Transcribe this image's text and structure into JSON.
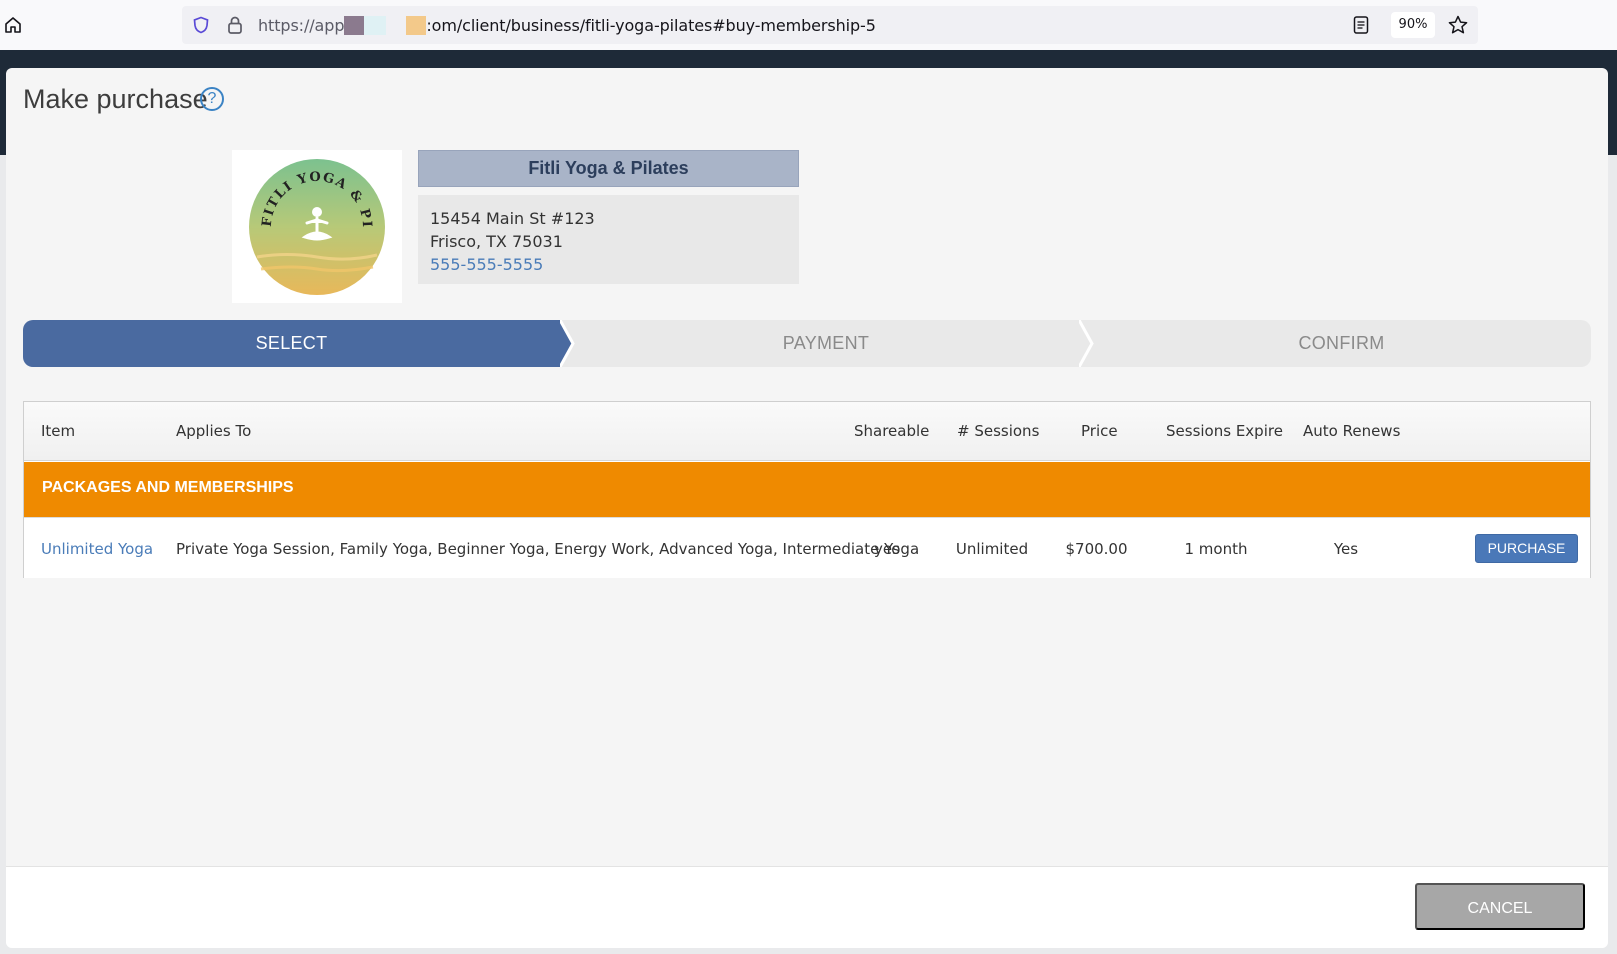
{
  "browser": {
    "url_prefix": "https://app",
    "url_suffix": ":om/client/business/fitli-yoga-pilates#buy-membership-5",
    "zoom": "90%"
  },
  "modal": {
    "title": "Make purchase",
    "help_glyph": "?"
  },
  "business": {
    "logo_text": "FITLI YOGA & PILATES",
    "name": "Fitli Yoga & Pilates",
    "address_line1": "15454 Main St #123",
    "address_line2": "Frisco, TX 75031",
    "phone": "555-555-5555"
  },
  "steps": [
    {
      "label": "SELECT",
      "active": true
    },
    {
      "label": "PAYMENT",
      "active": false
    },
    {
      "label": "CONFIRM",
      "active": false
    }
  ],
  "table": {
    "headers": {
      "item": "Item",
      "applies_to": "Applies To",
      "shareable": "Shareable",
      "sessions": "# Sessions",
      "price": "Price",
      "sessions_expire": "Sessions Expire",
      "auto_renews": "Auto Renews"
    },
    "section_label": "PACKAGES AND MEMBERSHIPS",
    "rows": [
      {
        "item": "Unlimited Yoga",
        "applies_to": "Private Yoga Session, Family Yoga, Beginner Yoga, Energy Work, Advanced Yoga, Intermediate Yoga",
        "shareable": "yes",
        "sessions": "Unlimited",
        "price": "$700.00",
        "sessions_expire": "1 month",
        "auto_renews": "Yes",
        "action": "PURCHASE"
      }
    ]
  },
  "footer": {
    "cancel_label": "CANCEL"
  },
  "colors": {
    "accent": "#4a6aa0",
    "section": "#ef8a00",
    "link": "#4a7cb8"
  }
}
